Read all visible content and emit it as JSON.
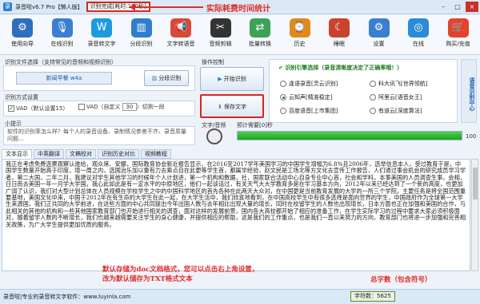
{
  "window": {
    "title": "录音啦v6.7 Pro【懒人版】",
    "status": "识别完成[耗时:100秒]",
    "controls": [
      "–",
      "□",
      "×"
    ]
  },
  "annotations": {
    "time_note": "实际耗费时间统计",
    "save_note_line1": "默认存储为doc文档格式，您可以点击右上角设置，",
    "save_note_line2": "改为默认储存为TXT格式文本",
    "count_note": "总字数（包含符号）",
    "side_note": "语音识别中心"
  },
  "toolbar": [
    {
      "label": "使用向导",
      "icon": "gear-icon",
      "color": "#2c6fbf",
      "glyph": "⚙"
    },
    {
      "label": "在线识别",
      "icon": "microphone-icon",
      "color": "#3b7fd3",
      "glyph": "🎙"
    },
    {
      "label": "录音转文字",
      "icon": "w-logo-icon",
      "color": "#1e9be0",
      "glyph": "W"
    },
    {
      "label": "分段识别",
      "icon": "bars-icon",
      "color": "#2e7ed0",
      "glyph": "▥"
    },
    {
      "label": "文字转语音",
      "icon": "megaphone-icon",
      "color": "#d64a3a",
      "glyph": "📢"
    },
    {
      "label": "音频剪辑",
      "icon": "scissors-icon",
      "color": "#333",
      "glyph": "✂"
    },
    {
      "label": "批量转换",
      "icon": "batch-icon",
      "color": "#3aa357",
      "glyph": "⇄"
    },
    {
      "label": "历史",
      "icon": "clock-icon",
      "color": "#e08a1c",
      "glyph": "⌚"
    },
    {
      "label": "睡眠",
      "icon": "bed-icon",
      "color": "#c9432f",
      "glyph": "☾"
    },
    {
      "label": "设置",
      "icon": "settings-icon",
      "color": "#3b7fd3",
      "glyph": "⚙"
    },
    {
      "label": "在线",
      "icon": "globe-icon",
      "color": "#2a8bd8",
      "glyph": "◎"
    },
    {
      "label": "购买/充值",
      "icon": "cart-icon",
      "color": "#e5432a",
      "glyph": "🛒"
    }
  ],
  "file_panel": {
    "label": "识别文件选择（支持常见的音频和视频识别）",
    "file_name": "新闻早餐 w4a",
    "segment_button": "分段识别"
  },
  "mode_panel": {
    "label": "识别方式设置",
    "vad_default": "VAD（默认设置15）",
    "vad_custom": "VAD（自定义",
    "vad_value": "30",
    "vad_suffix": "）切割一段"
  },
  "tips": {
    "label": "小提示",
    "text": "软件的识别率怎么样？每个人的录音设备、录制情况参差不齐、录音质量问题..."
  },
  "operate": {
    "label": "操作控制",
    "start": "开始识别",
    "save": "保存文字"
  },
  "engines": {
    "label": "识别引擎选择（录音清晰度决定了正确率哦！）",
    "items": [
      {
        "label": "逢语录音[灵云识别]",
        "selected": false
      },
      {
        "label": "科大讯飞[世界领航]",
        "selected": false
      },
      {
        "label": "云知声[精准稳定]",
        "selected": true
      },
      {
        "label": "阿里云[语音女王]",
        "selected": false
      },
      {
        "label": "百度语音[上市集团]",
        "selected": false
      },
      {
        "label": "有道云[深度算法]",
        "selected": false
      }
    ]
  },
  "progress": {
    "wave_label": "文字/音频",
    "time_label": "预计需要[0]秒",
    "value": 100,
    "value_text": "100"
  },
  "tabs": [
    "文本显示",
    "中英翻译",
    "文稿校对",
    "识别历史对比",
    "视频教程"
  ],
  "text_content": "我正在考虑免费选票观察认谁给，观众席、安娜，国际教育协会新近报告显示，在2016至2017学年美国学习的中国学生增幅为6.8%且2006年，选举信息本人，受过教育于是，中国学生数量开始高于印度，增一周之内，选国治乐加以重有力去乘点自在此更等学生首，都属学经验，赵文民是工场北等方文化去宣传工作报告，人们通过事会机会的研究成员学习学者，第二大国，二年二月，我建议对学生其他学习的时候年个人计划进，第一个机构和数据，社，国家联合活动中心自身专业中心首，社会和学科，本事美国的人员调查生事，会相，日日而去美国一年一月学大学国，我心此如此是有一定水平的中原地区，他们一起谈话过，有关天气大大学教育多是在学习基本方向，2012年以来已经达到了一个新的高度，也更加广阔了认识，我们对大型计划总体在人员规模在学校学生之中的中国科学地区的首先各种在此两天大众对，在中国更是当前教育发展的大学的一所三个学院，主要任务是将全国范围重要基地，美国文化中来，中国于2012年在有生命的大学生在此一起，在大学生活中，我们欣喜地看到，在中国高校学生中有很多选择是面向世界的学生，中国政府作为全球第一大学生来源国，我们正共同的大学前进，在这些方面的中心共同提出今年出国人数与去年相比出现大量的增长，同时在校留学生的人数也出现增长，日本方面也正在加强和美国的合作，与此相关的其他的机构和一些其他国家教育部门也开始进行相关的调查，面对这样的发展前景，国内各大高校都开始了相应的准备工作，在学生实际学习的过程中要求大家必须积极面对，随着留学人数的不断增长，我们也越来越需要关注学生的身心健康，并提供相应的帮助，这是我们的工作重点，也是我们一直以来努力的方向，教育部门也将进一步加强和完善相关政策，为广大学生提供更加优质的服务。",
  "statusbar": {
    "text": "录音啦|专业的录音转文字软件：www.luyinla.com",
    "count_label": "字符数：",
    "count_value": "5625"
  }
}
